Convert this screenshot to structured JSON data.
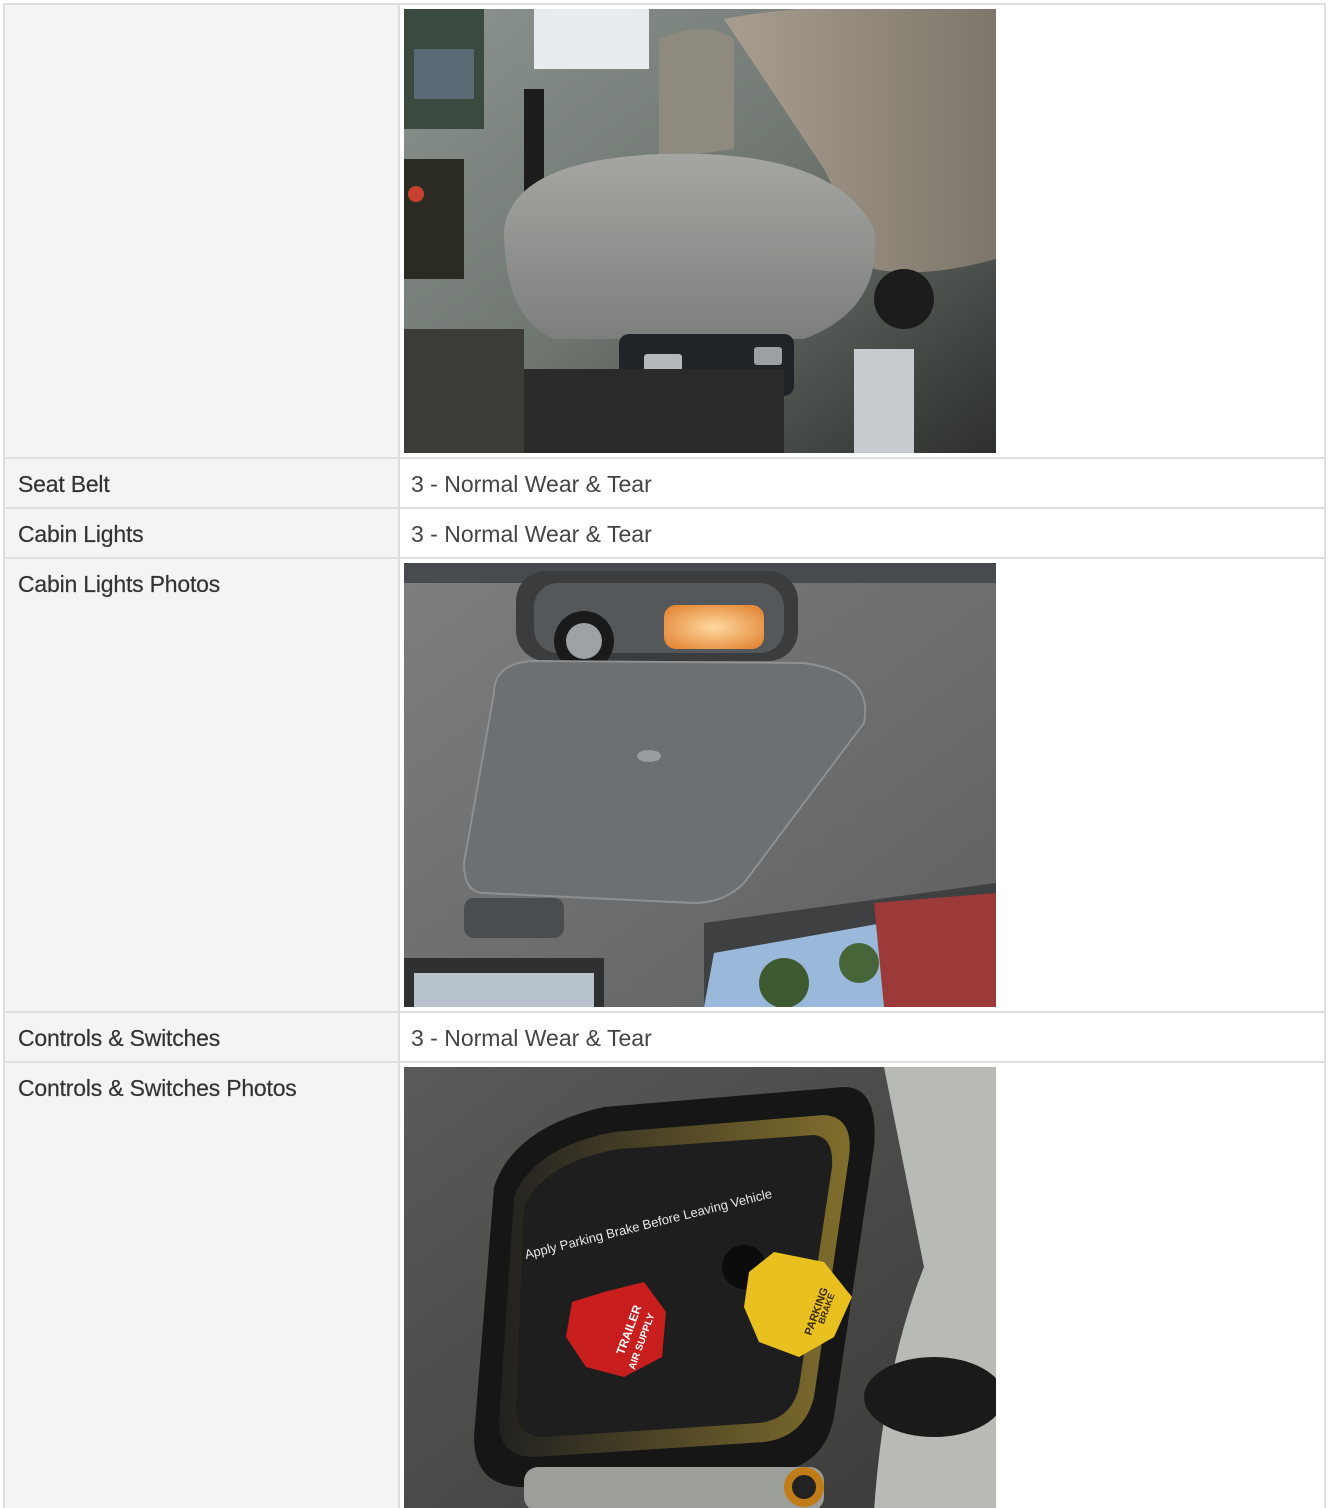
{
  "rows": [
    {
      "label": "",
      "type": "photo",
      "photo_name": "seat-photo"
    },
    {
      "label": "Seat Belt",
      "type": "text",
      "value": "3 - Normal Wear & Tear"
    },
    {
      "label": "Cabin Lights",
      "type": "text",
      "value": "3 - Normal Wear & Tear"
    },
    {
      "label": "Cabin Lights Photos",
      "type": "photo",
      "photo_name": "cabin-lights-photo"
    },
    {
      "label": "Controls & Switches",
      "type": "text",
      "value": "3 - Normal Wear & Tear"
    },
    {
      "label": "Controls & Switches Photos",
      "type": "photo",
      "photo_name": "controls-switches-photo"
    }
  ],
  "photo_text": {
    "brake_panel_caption": "Apply Parking Brake Before Leaving Vehicle",
    "trailer_knob_line1": "TRAILER",
    "trailer_knob_line2": "AIR SUPPLY",
    "parking_knob_line1": "PARKING",
    "parking_knob_line2": "BRAKE"
  },
  "colors": {
    "label_bg": "#f4f4f4",
    "border": "#dedede",
    "label_text": "#333333",
    "value_text": "#444444"
  }
}
